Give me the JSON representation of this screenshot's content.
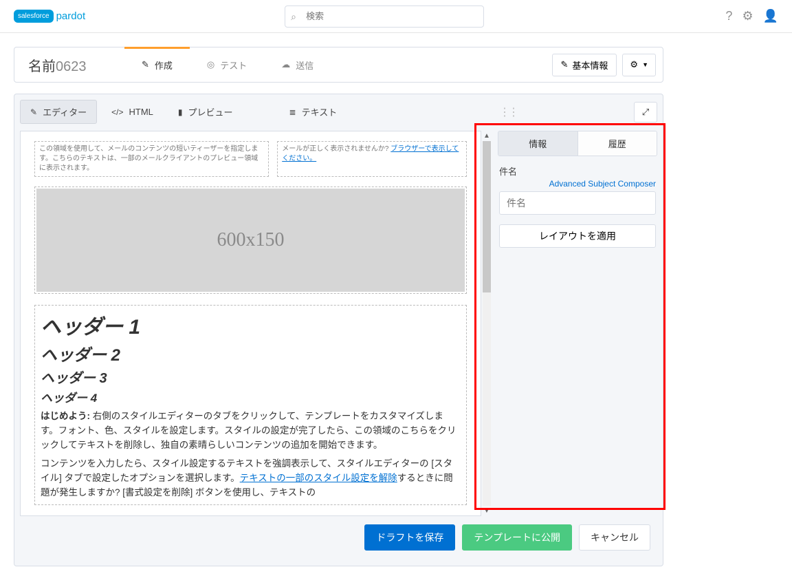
{
  "brand": {
    "badge": "salesforce",
    "product": "pardot"
  },
  "search": {
    "placeholder": "検索"
  },
  "header": {
    "title_prefix": "名前",
    "title_suffix": "0623",
    "steps": {
      "compose": "作成",
      "test": "テスト",
      "send": "送信"
    },
    "basic_info": "基本情報"
  },
  "tools": {
    "editor": "エディター",
    "html": "HTML",
    "preview": "プレビュー",
    "text": "テキスト"
  },
  "canvas": {
    "teaser_left": "この領域を使用して、メールのコンテンツの短いティーザーを指定します。こちらのテキストは、一部のメールクライアントのプレビュー領域に表示されます。",
    "teaser_right_lead": "メールが正しく表示されませんか? ",
    "teaser_right_link": "ブラウザーで表示してください。",
    "hero_label": "600x150",
    "h1": "ヘッダー 1",
    "h2": "ヘッダー 2",
    "h3": "ヘッダー 3",
    "h4": "ヘッダー 4",
    "p1_lead": "はじめよう:",
    "p1_rest": " 右側のスタイルエディターのタブをクリックして、テンプレートをカスタマイズします。フォント、色、スタイルを設定します。スタイルの設定が完了したら、この領域のこちらをクリックしてテキストを削除し、独自の素晴らしいコンテンツの追加を開始できます。",
    "p2_a": "コンテンツを入力したら、スタイル設定するテキストを強調表示して、スタイルエディターの [スタイル] タブで設定したオプションを選択します。",
    "p2_link": "テキストの一部のスタイル設定を解除",
    "p2_b": "するときに問題が発生しますか? [書式設定を削除] ボタンを使用し、テキストの"
  },
  "side": {
    "tab_info": "情報",
    "tab_history": "履歴",
    "subject_label": "件名",
    "advanced_link": "Advanced Subject Composer",
    "subject_placeholder": "件名",
    "apply_layout": "レイアウトを適用"
  },
  "footer": {
    "save_draft": "ドラフトを保存",
    "publish": "テンプレートに公開",
    "cancel": "キャンセル"
  }
}
